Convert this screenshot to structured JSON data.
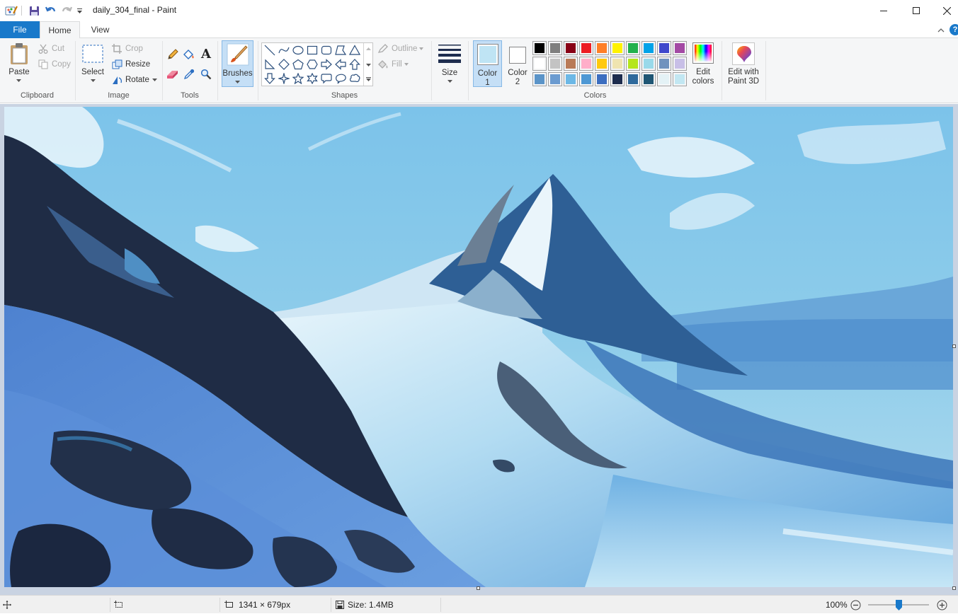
{
  "window": {
    "title": "daily_304_final - Paint",
    "minimize_icon": "minimize-icon",
    "maximize_icon": "maximize-icon",
    "close_icon": "close-icon"
  },
  "tabs": [
    {
      "label": "File"
    },
    {
      "label": "Home"
    },
    {
      "label": "View"
    }
  ],
  "clipboard": {
    "group_label": "Clipboard",
    "paste": "Paste",
    "cut": "Cut",
    "copy": "Copy"
  },
  "image": {
    "group_label": "Image",
    "select": "Select",
    "crop": "Crop",
    "resize": "Resize",
    "rotate": "Rotate"
  },
  "tools": {
    "group_label": "Tools",
    "text_glyph": "A"
  },
  "brushes": {
    "label": "Brushes"
  },
  "shapes": {
    "group_label": "Shapes",
    "outline": "Outline",
    "fill": "Fill"
  },
  "size": {
    "label": "Size"
  },
  "colors": {
    "group_label": "Colors",
    "color1_label": "Color",
    "color1_num": "1",
    "color2_label": "Color",
    "color2_num": "2",
    "color1_value": "#bfe4f4",
    "color2_value": "#ffffff",
    "edit_colors_line1": "Edit",
    "edit_colors_line2": "colors",
    "palette": [
      "#000000",
      "#7f7f7f",
      "#880015",
      "#ed1c24",
      "#ff7f27",
      "#fff200",
      "#22b14c",
      "#00a2e8",
      "#3f48cc",
      "#a349a4",
      "#ffffff",
      "#c3c3c3",
      "#b97a57",
      "#ffaec9",
      "#ffc90e",
      "#efe4b0",
      "#b5e61d",
      "#99d9ea",
      "#7092be",
      "#c8bfe7",
      "#5b94c8",
      "#6b9bd0",
      "#6cb8e6",
      "#4e98d4",
      "#3c6ec0",
      "#1e2d4e",
      "#2f6a9c",
      "#1f5674",
      "#e4f2f6",
      "#c2e7f2"
    ]
  },
  "paint3d": {
    "line1": "Edit with",
    "line2": "Paint 3D"
  },
  "status": {
    "dimensions": "1341 × 679px",
    "size": "Size: 1.4MB",
    "zoom": "100%",
    "zoom_level": 1.0
  }
}
